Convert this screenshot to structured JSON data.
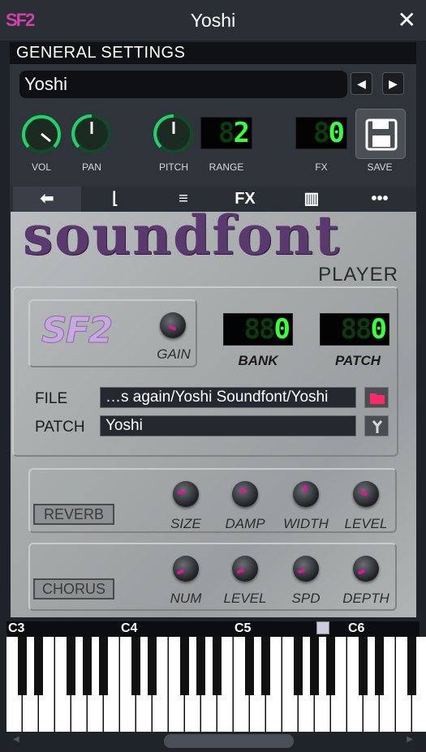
{
  "window": {
    "title": "Yoshi",
    "icon_text": "SF2",
    "close_symbol": "✕"
  },
  "general": {
    "header": "GENERAL SETTINGS",
    "instrument_name": "Yoshi",
    "prev_symbol": "◀",
    "next_symbol": "▶",
    "knobs": {
      "vol_label": "VOL",
      "pan_label": "PAN",
      "pitch_label": "PITCH"
    },
    "range": {
      "label": "RANGE",
      "value": "2",
      "ghost": "8"
    },
    "fx": {
      "label": "FX",
      "value": "0",
      "ghost": "8"
    },
    "save_label": "SAVE",
    "accent_color": "#22d16a"
  },
  "tabs": [
    {
      "name": "plug-icon",
      "symbol": "⬅"
    },
    {
      "name": "envelope-icon",
      "symbol": "⌊"
    },
    {
      "name": "arpeggio-icon",
      "symbol": "≡"
    },
    {
      "name": "fx-tab",
      "symbol": "FX"
    },
    {
      "name": "piano-icon",
      "symbol": "▥"
    },
    {
      "name": "more-icon",
      "symbol": "•••"
    }
  ],
  "plugin": {
    "logo": "soundfont",
    "subtitle": "PLAYER",
    "sf2_badge": "SF2",
    "gain_label": "GAIN",
    "bank": {
      "label": "BANK",
      "value": "0",
      "ghost": "88"
    },
    "patch": {
      "label": "PATCH",
      "value": "0",
      "ghost": "88"
    },
    "file_label": "FILE",
    "file_value": "…s again/Yoshi Soundfont/Yoshi",
    "patch_label": "PATCH",
    "patch_value": "Yoshi",
    "reverb": {
      "button": "REVERB",
      "knobs": [
        "SIZE",
        "DAMP",
        "WIDTH",
        "LEVEL"
      ]
    },
    "chorus": {
      "button": "CHORUS",
      "knobs": [
        "NUM",
        "LEVEL",
        "SPD",
        "DEPTH"
      ]
    },
    "knob_indicator_color": "#e0169a"
  },
  "piano": {
    "octaves": [
      "C3",
      "C4",
      "C5",
      "C6"
    ]
  }
}
